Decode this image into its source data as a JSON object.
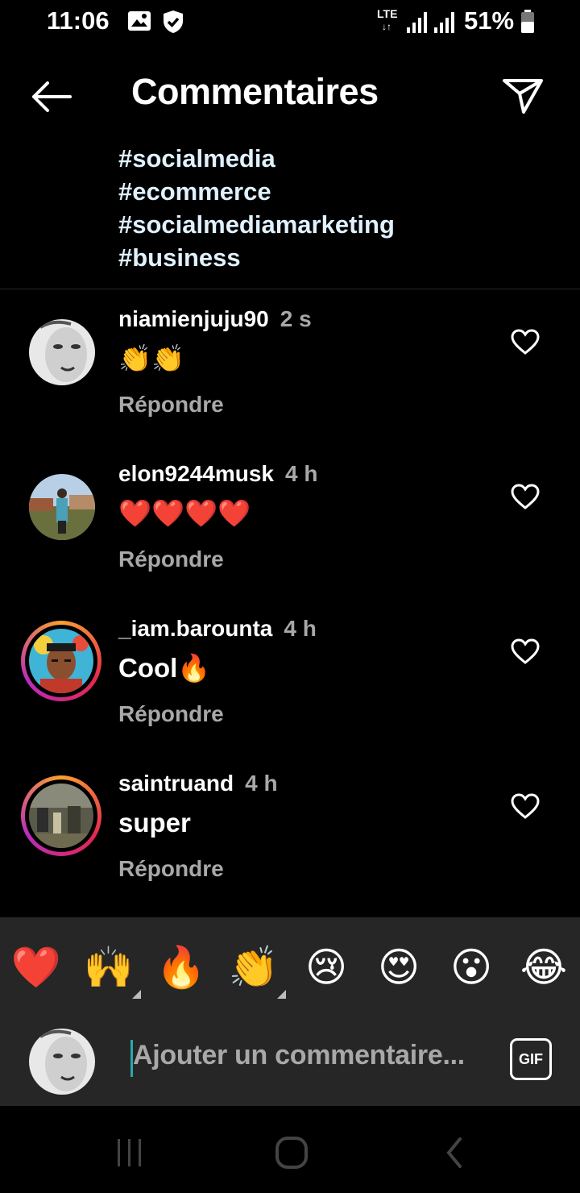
{
  "status": {
    "time": "11:06",
    "network": "LTE",
    "battery": "51%"
  },
  "header": {
    "title": "Commentaires"
  },
  "post": {
    "hashtags": [
      "#socialmedia",
      "#ecommerce",
      "#socialmediamarketing",
      "#business"
    ]
  },
  "comments": [
    {
      "user": "niamienjuju90",
      "time": "2 s",
      "text": "👏👏",
      "reply": "Répondre"
    },
    {
      "user": "elon9244musk",
      "time": "4 h",
      "text": "❤️❤️❤️❤️",
      "reply": "Répondre"
    },
    {
      "user": "_iam.barounta",
      "time": "4 h",
      "text": "Cool🔥",
      "reply": "Répondre"
    },
    {
      "user": "saintruand",
      "time": "4 h",
      "text": "super",
      "reply": "Répondre"
    }
  ],
  "reactions": [
    "❤️",
    "🙌",
    "🔥",
    "👏",
    "😢",
    "😍",
    "😮",
    "😂"
  ],
  "composer": {
    "placeholder": "Ajouter un commentaire...",
    "gif_label": "GIF"
  },
  "colors": {
    "background": "#000000",
    "hashtag": "#e0f1ff",
    "muted": "#a8a8a8",
    "reaction_bar": "#262626",
    "caret": "#2aa7b2"
  }
}
